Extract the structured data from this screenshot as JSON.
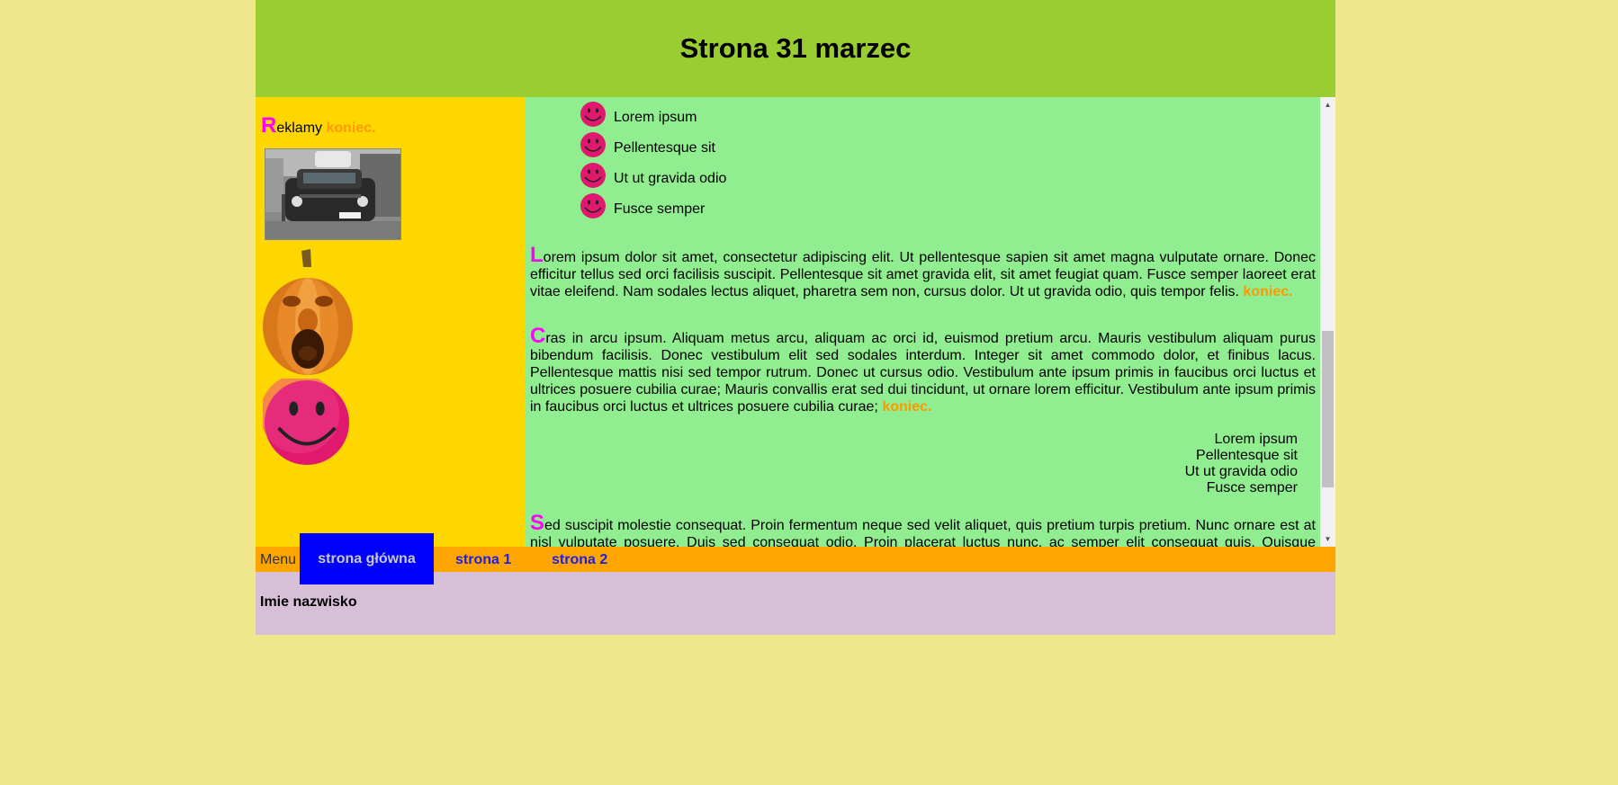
{
  "header": {
    "title": "Strona 31 marzec"
  },
  "sidebar": {
    "ads_cap": "R",
    "ads_rest": "eklamy ",
    "ads_end": "koniec."
  },
  "content": {
    "smiley_list": [
      "Lorem ipsum",
      "Pellentesque sit",
      "Ut ut gravida odio",
      "Fusce semper"
    ],
    "paragraphs": [
      {
        "cap": "L",
        "text": "orem ipsum dolor sit amet, consectetur adipiscing elit. Ut pellentesque sapien sit amet magna vulputate ornare. Donec efficitur tellus sed orci facilisis suscipit. Pellentesque sit amet gravida elit, sit amet feugiat quam. Fusce semper laoreet erat vitae eleifend. Nam sodales lectus aliquet, pharetra sem non, cursus dolor. Ut ut gravida odio, quis tempor felis. ",
        "end": "koniec."
      },
      {
        "cap": "C",
        "text": "ras in arcu ipsum. Aliquam metus arcu, aliquam ac orci id, euismod pretium arcu. Mauris vestibulum aliquam purus bibendum facilisis. Donec vestibulum elit sed sodales interdum. Integer sit amet commodo dolor, et finibus lacus. Pellentesque mattis nisi sed tempor rutrum. Donec ut cursus odio. Vestibulum ante ipsum primis in faucibus orci luctus et ultrices posuere cubilia curae; Mauris convallis erat sed dui tincidunt, ut ornare lorem efficitur. Vestibulum ante ipsum primis in faucibus orci luctus et ultrices posuere cubilia curae; ",
        "end": "koniec."
      },
      {
        "cap": "S",
        "text": "ed suscipit molestie consequat. Proin fermentum neque sed velit aliquet, quis pretium turpis pretium. Nunc ornare est at nisl vulputate posuere. Duis sed consequat odio. Proin placerat luctus nunc, ac semper elit consequat quis. Quisque ultricies enim nec ex faucibus ullamcorper. Suspendisse nec mi non leo euismod scelerisque et eu ipsum. Cras id ex",
        "end": ""
      }
    ],
    "circle_list": [
      "Lorem ipsum",
      "Pellentesque sit",
      "Ut ut gravida odio",
      "Fusce semper"
    ]
  },
  "menu": {
    "label": "Menu",
    "items": [
      "strona główna",
      "strona 1",
      "strona 2"
    ]
  },
  "footer": {
    "text": "Imie nazwisko"
  },
  "colors": {
    "background": "#f0e68c",
    "header": "#9acd32",
    "sidebar": "#ffd700",
    "content": "#90ee90",
    "menu_bar": "#ffa500",
    "menu_active": "#0000ff",
    "footer": "#d8bfd8",
    "drop_cap": "#ff00ff",
    "koniec": "#ff9900"
  }
}
